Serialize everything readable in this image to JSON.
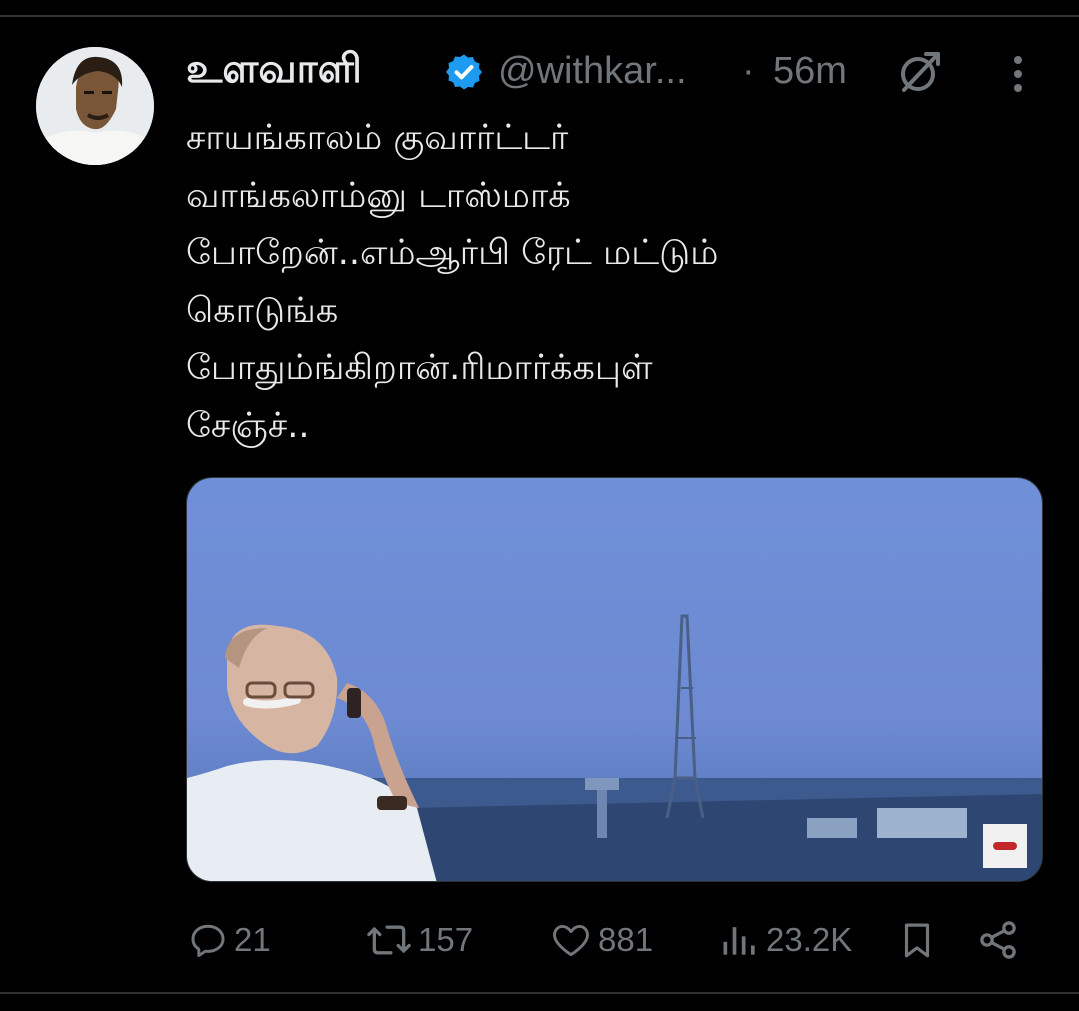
{
  "tweet": {
    "author_name": "உளவாளி",
    "handle": "@withkar...",
    "separator": "·",
    "time": "56m",
    "text_lines": [
      "சாயங்காலம் குவார்ட்டர்",
      "வாங்கலாம்னு டாஸ்மாக்",
      "போறேன்..எம்ஆர்பி ரேட் மட்டும்",
      "கொடுங்க",
      "போதும்ங்கிறான்.ரிமார்க்கபுள்",
      "சேஞ்ச்.."
    ]
  },
  "actions": {
    "replies": "21",
    "retweets": "157",
    "likes": "881",
    "views": "23.2K"
  },
  "icons": {
    "verified": "verified-badge-icon",
    "grok": "grok-icon",
    "more": "more-vertical-icon",
    "reply": "reply-icon",
    "retweet": "retweet-icon",
    "like": "heart-icon",
    "views": "views-icon",
    "bookmark": "bookmark-icon",
    "share": "share-icon"
  },
  "colors": {
    "background": "#000000",
    "text": "#e7e9ea",
    "muted": "#71767b",
    "verified": "#1d9bf0",
    "divider": "#2f3336"
  }
}
